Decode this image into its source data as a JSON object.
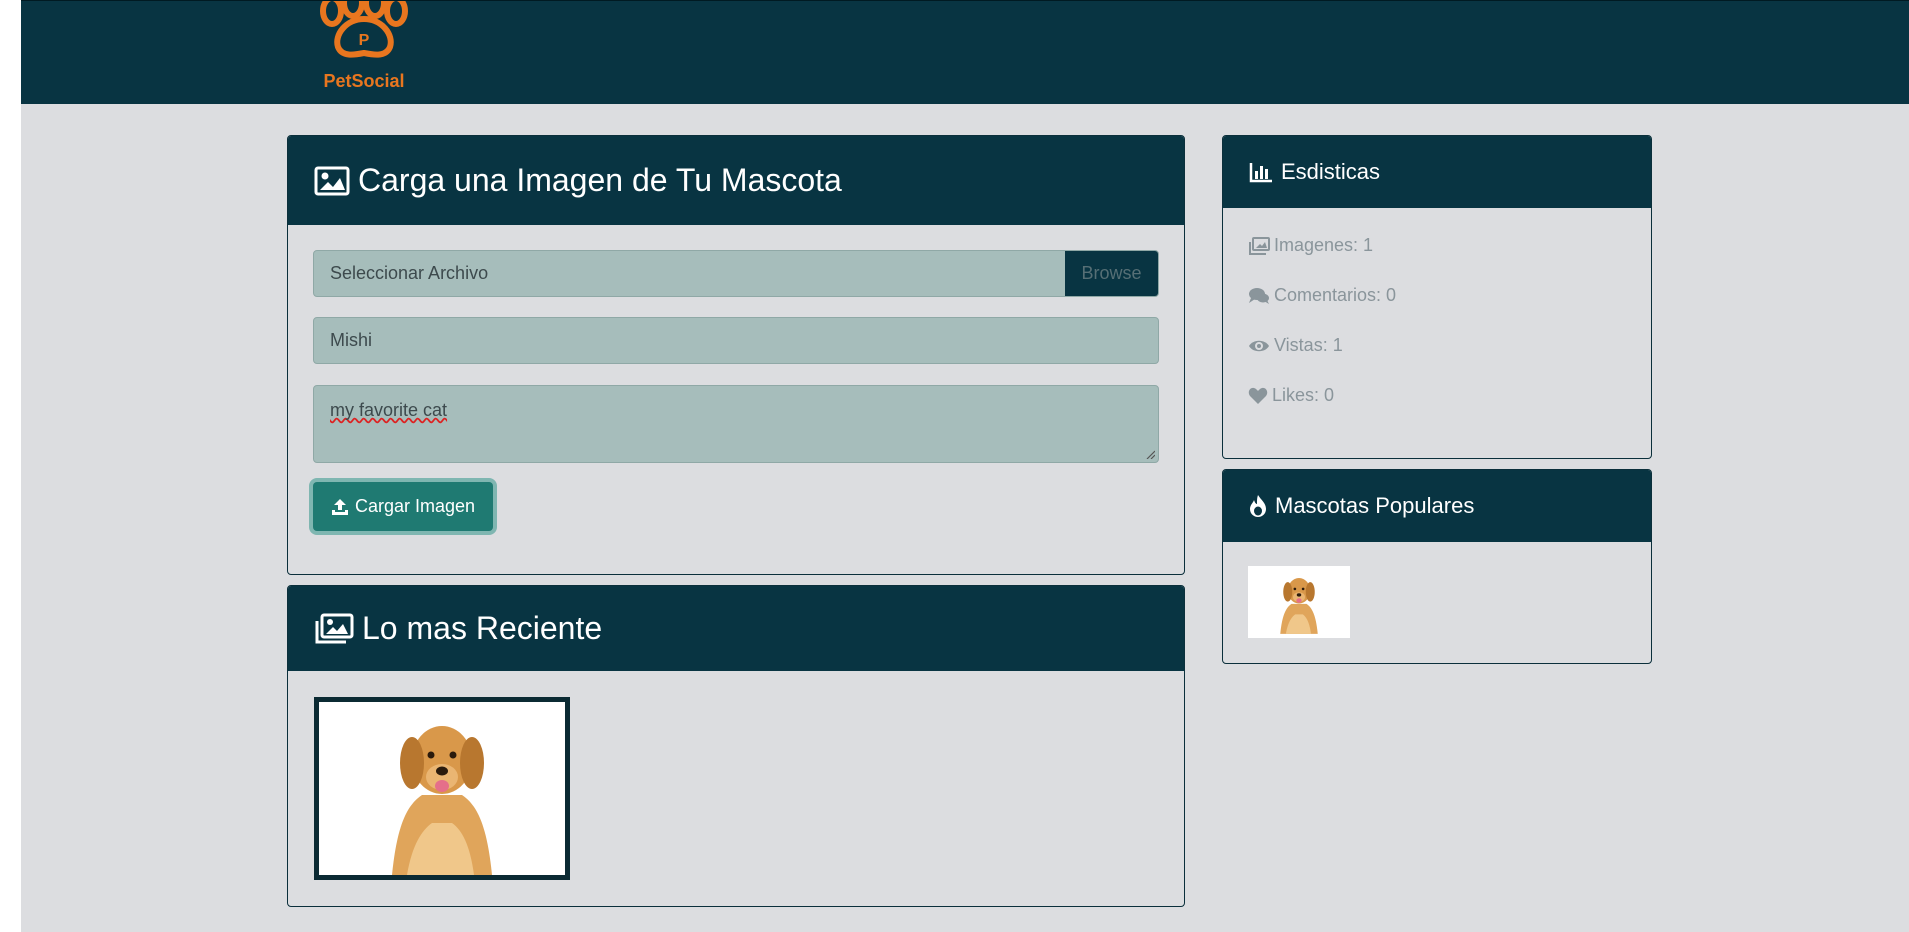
{
  "app": {
    "brand": "PetSocial",
    "brand_color": "#e8761f",
    "primary_color": "#083442"
  },
  "upload": {
    "title": "Carga una Imagen de Tu Mascota",
    "title_icon": "image-icon",
    "file_placeholder": "Seleccionar Archivo",
    "browse_label": "Browse",
    "name_value": "Mishi",
    "description_value": "my favorite cat",
    "submit_label": "Cargar Imagen",
    "submit_icon": "upload-icon"
  },
  "recent": {
    "title": "Lo mas Reciente",
    "title_icon": "images-icon",
    "images": [
      {
        "alt_icon": "golden-retriever-photo"
      }
    ]
  },
  "stats": {
    "title": "Esdisticas",
    "title_icon": "bar-chart-icon",
    "items": [
      {
        "icon": "images-icon",
        "label": "Imagenes: 1"
      },
      {
        "icon": "comments-icon",
        "label": "Comentarios: 0"
      },
      {
        "icon": "eye-icon",
        "label": "Vistas: 1"
      },
      {
        "icon": "heart-icon",
        "label": "Likes: 0"
      }
    ]
  },
  "popular": {
    "title": "Mascotas Populares",
    "title_icon": "fire-icon",
    "images": [
      {
        "alt_icon": "golden-retriever-photo"
      }
    ]
  }
}
